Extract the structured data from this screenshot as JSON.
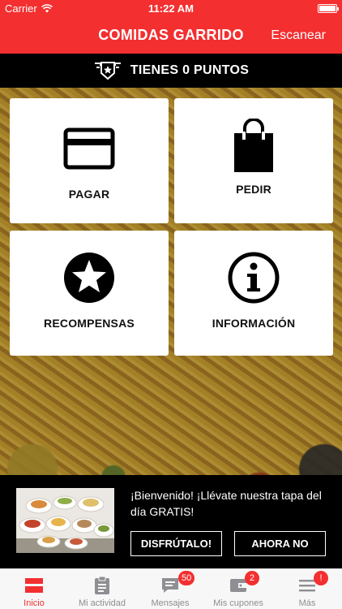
{
  "status_bar": {
    "carrier": "Carrier",
    "time": "11:22 AM"
  },
  "nav": {
    "title": "COMIDAS GARRIDO",
    "action_label": "Escanear"
  },
  "points": {
    "label": "TIENES 0 PUNTOS",
    "icon": "rank-badge-icon"
  },
  "tiles": [
    {
      "label": "PAGAR",
      "icon": "credit-card-icon"
    },
    {
      "label": "PEDIR",
      "icon": "shopping-bag-icon"
    },
    {
      "label": "RECOMPENSAS",
      "icon": "star-circle-icon"
    },
    {
      "label": "INFORMACIÓN",
      "icon": "info-circle-icon"
    }
  ],
  "promo": {
    "message": "¡Bienvenido! ¡Llévate nuestra tapa del día GRATIS!",
    "accept_label": "DISFRÚTALO!",
    "dismiss_label": "AHORA NO"
  },
  "tabs": [
    {
      "label": "Inicio",
      "icon": "home-icon",
      "active": true
    },
    {
      "label": "Mi actividad",
      "icon": "clipboard-icon"
    },
    {
      "label": "Mensajes",
      "icon": "chat-icon",
      "badge": "50"
    },
    {
      "label": "Mis cupones",
      "icon": "wallet-icon",
      "badge": "2"
    },
    {
      "label": "Más",
      "icon": "menu-icon",
      "badge": "!"
    }
  ],
  "colors": {
    "brand_red": "#f32f30",
    "black": "#000000",
    "white": "#ffffff"
  }
}
